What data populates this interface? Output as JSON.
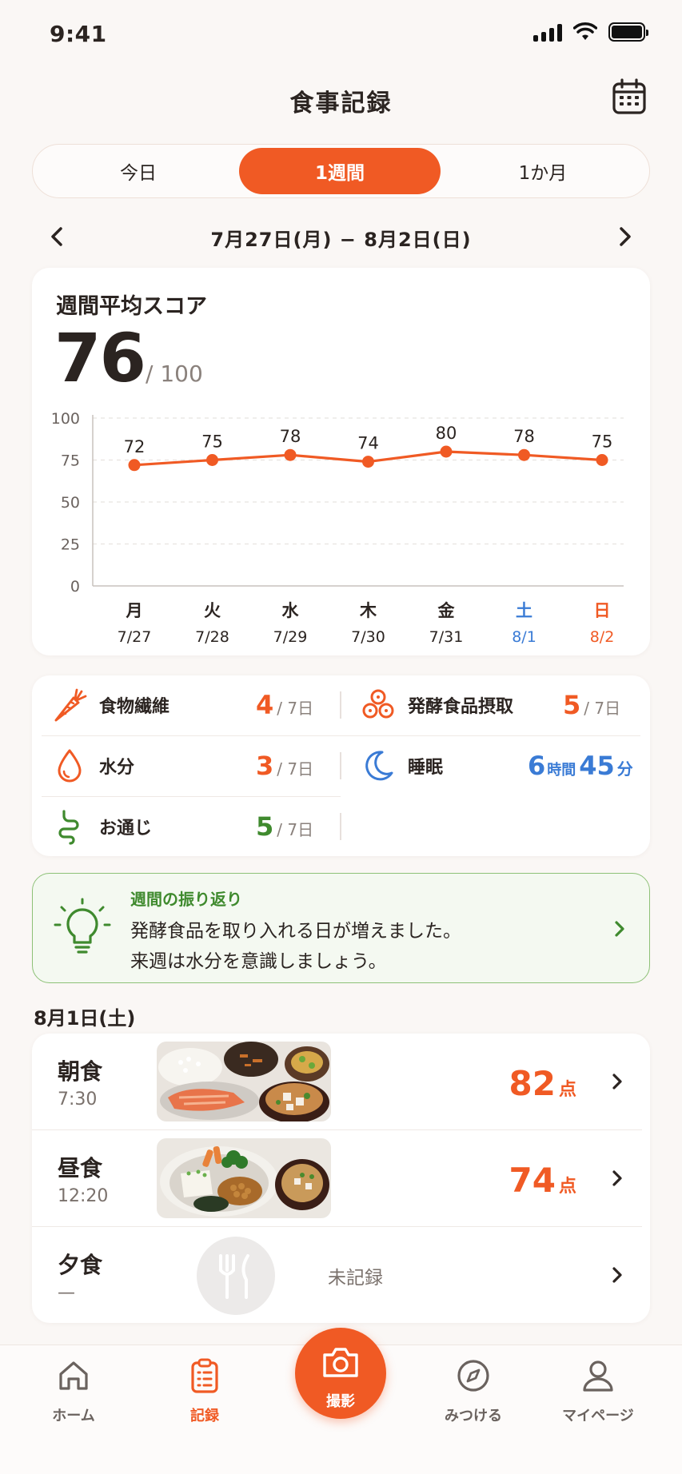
{
  "status": {
    "time": "9:41"
  },
  "header": {
    "title": "食事記録"
  },
  "segments": [
    "今日",
    "1週間",
    "1か月"
  ],
  "segments_active": 1,
  "date_range": "7月27日(月) − 8月2日(日)",
  "score_card": {
    "title": "週間平均スコア",
    "score": "76",
    "max": "/ 100"
  },
  "chart_data": {
    "type": "line",
    "categories": [
      "月",
      "火",
      "水",
      "木",
      "金",
      "土",
      "日"
    ],
    "dates": [
      "7/27",
      "7/28",
      "7/29",
      "7/30",
      "7/31",
      "8/1",
      "8/2"
    ],
    "values": [
      72,
      75,
      78,
      74,
      80,
      78,
      75
    ],
    "ylim": [
      0,
      100
    ],
    "yticks": [
      0,
      25,
      50,
      75,
      100
    ],
    "grid": true,
    "colors": {
      "line": "#f05a24",
      "weekday": "#2b2421",
      "saturday": "#3a7bd5",
      "sunday": "#f05a24"
    }
  },
  "stats": {
    "fiber": {
      "label": "食物繊維",
      "value": "4",
      "denom": "/ 7日",
      "color": "#f05a24"
    },
    "ferment": {
      "label": "発酵食品摂取",
      "value": "5",
      "denom": "/ 7日",
      "color": "#f05a24"
    },
    "water": {
      "label": "水分",
      "value": "3",
      "denom": "/ 7日",
      "color": "#f05a24"
    },
    "sleep": {
      "label": "睡眠",
      "hours": "6",
      "hours_unit": "時間",
      "minutes": "45",
      "minutes_unit": "分",
      "color": "#3a7bd5"
    },
    "bowel": {
      "label": "お通じ",
      "value": "5",
      "denom": "/ 7日",
      "color": "#3f8a2e"
    }
  },
  "tip": {
    "heading": "週間の振り返り",
    "line1": "発酵食品を取り入れる日が増えました。",
    "line2": "来週は水分を意識しましょう。"
  },
  "day_label": "8月1日(土)",
  "meals": [
    {
      "name": "朝食",
      "time": "7:30",
      "score": "82",
      "unit": "点"
    },
    {
      "name": "昼食",
      "time": "12:20",
      "score": "74",
      "unit": "点"
    },
    {
      "name": "夕食",
      "time": "—",
      "status": "未記録"
    }
  ],
  "tabbar": {
    "home": "ホーム",
    "record": "記録",
    "camera": "撮影",
    "discover": "みつける",
    "mypage": "マイページ"
  },
  "icons": [
    "calendar-icon",
    "chevron-left-icon",
    "chevron-right-icon",
    "carrot-icon",
    "ferment-icon",
    "droplet-icon",
    "moon-icon",
    "intestine-icon",
    "lightbulb-icon",
    "fork-knife-icon",
    "home-icon",
    "clipboard-icon",
    "camera-icon",
    "compass-icon",
    "user-icon"
  ]
}
